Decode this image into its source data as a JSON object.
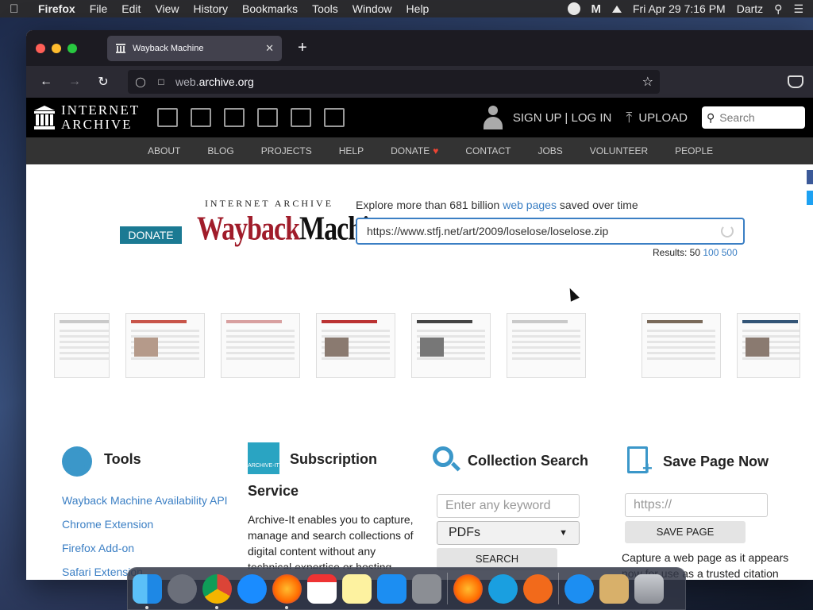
{
  "menubar": {
    "app": "Firefox",
    "items": [
      "File",
      "Edit",
      "View",
      "History",
      "Bookmarks",
      "Tools",
      "Window",
      "Help"
    ],
    "clock": "Fri Apr 29  7:16 PM",
    "user": "Dartz"
  },
  "browser": {
    "tab_title": "Wayback Machine",
    "url_host_dim": "web.",
    "url_host": "archive.org"
  },
  "ia_header": {
    "logo_line1": "INTERNET",
    "logo_line2": "ARCHIVE",
    "signup": "SIGN UP | LOG IN",
    "upload": "UPLOAD",
    "search_placeholder": "Search",
    "subnav": [
      "ABOUT",
      "BLOG",
      "PROJECTS",
      "HELP",
      "DONATE",
      "CONTACT",
      "JOBS",
      "VOLUNTEER",
      "PEOPLE"
    ]
  },
  "wayback": {
    "donate": "DONATE",
    "logo_top": "INTERNET ARCHIVE",
    "logo_a": "Wayback",
    "logo_b": "Machine",
    "explore_pre": "Explore more than 681 billion ",
    "explore_link": "web pages",
    "explore_post": " saved over time",
    "input_value": "https://www.stfj.net/art/2009/loselose/loselose.zip",
    "results_label": "Results: 50",
    "results_100": "100",
    "results_500": "500"
  },
  "tools": {
    "tools_title": "Tools",
    "tools_links": [
      "Wayback Machine Availability API",
      "Chrome Extension",
      "Firefox Add-on",
      "Safari Extension"
    ],
    "sub_title_1": "Subscription",
    "sub_title_2": "Service",
    "archive_it_label": "ARCHIVE-IT",
    "sub_text": "Archive-It enables you to capture, manage and search collections of digital content without any technical expertise or hosting",
    "coll_title": "Collection Search",
    "coll_placeholder": "Enter any keyword",
    "coll_select": "PDFs",
    "coll_button": "SEARCH",
    "save_title": "Save Page Now",
    "save_placeholder": "https://",
    "save_button": "SAVE PAGE",
    "save_text": "Capture a web page as it appears now for use as a trusted citation"
  },
  "colors": {
    "accent": "#3b7fc4",
    "donate_bg": "#1b7a93",
    "wayback_red": "#a01c2a"
  }
}
